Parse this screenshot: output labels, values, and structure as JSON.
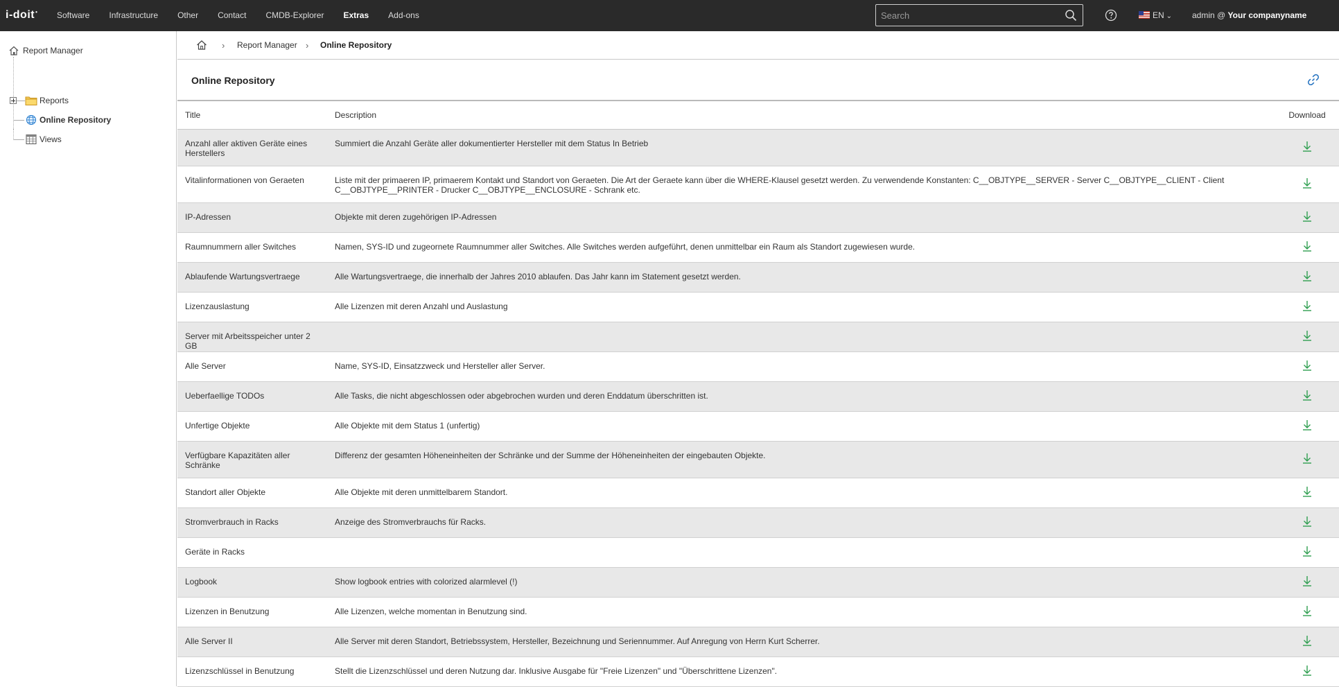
{
  "topbar": {
    "logo": "i-doit",
    "nav": [
      "Software",
      "Infrastructure",
      "Other",
      "Contact",
      "CMDB-Explorer",
      "Extras",
      "Add-ons"
    ],
    "active_nav": "Extras",
    "search_placeholder": "Search",
    "language": "EN",
    "user_prefix": "admin @",
    "company": "Your companyname"
  },
  "sidebar": {
    "root": "Report Manager",
    "items": [
      "Reports",
      "Online Repository",
      "Views"
    ],
    "active": "Online Repository"
  },
  "breadcrumb": {
    "items": [
      "Report Manager",
      "Online Repository"
    ]
  },
  "page": {
    "title": "Online Repository"
  },
  "table": {
    "columns": [
      "Title",
      "Description",
      "Download"
    ],
    "rows": [
      {
        "title": "Anzahl aller aktiven Geräte eines Herstellers",
        "description": "Summiert die Anzahl Geräte aller dokumentierter Hersteller mit dem Status In Betrieb"
      },
      {
        "title": "Vitalinformationen von Geraeten",
        "description": "Liste mit der primaeren IP, primaerem Kontakt und Standort von Geraeten. Die Art der Geraete kann über die WHERE-Klausel gesetzt werden. Zu verwendende Konstanten: C__OBJTYPE__SERVER - Server C__OBJTYPE__CLIENT - Client C__OBJTYPE__PRINTER - Drucker C__OBJTYPE__ENCLOSURE - Schrank etc."
      },
      {
        "title": "IP-Adressen",
        "description": "Objekte mit deren zugehörigen IP-Adressen"
      },
      {
        "title": "Raumnummern aller Switches",
        "description": "Namen, SYS-ID und zugeornete Raumnummer aller Switches. Alle Switches werden aufgeführt, denen unmittelbar ein Raum als Standort zugewiesen wurde."
      },
      {
        "title": "Ablaufende Wartungsvertraege",
        "description": "Alle Wartungsvertraege, die innerhalb der Jahres 2010 ablaufen. Das Jahr kann im Statement gesetzt werden."
      },
      {
        "title": "Lizenzauslastung",
        "description": "Alle Lizenzen mit deren Anzahl und Auslastung"
      },
      {
        "title": "Server mit Arbeitsspeicher unter 2 GB",
        "description": ""
      },
      {
        "title": "Alle Server",
        "description": "Name, SYS-ID, Einsatzzweck und Hersteller aller Server."
      },
      {
        "title": "Ueberfaellige TODOs",
        "description": "Alle Tasks, die nicht abgeschlossen oder abgebrochen wurden und deren Enddatum überschritten ist."
      },
      {
        "title": "Unfertige Objekte",
        "description": "Alle Objekte mit dem Status 1 (unfertig)"
      },
      {
        "title": "Verfügbare Kapazitäten aller Schränke",
        "description": "Differenz der gesamten Höheneinheiten der Schränke und der Summe der Höheneinheiten der eingebauten Objekte."
      },
      {
        "title": "Standort aller Objekte",
        "description": "Alle Objekte mit deren unmittelbarem Standort."
      },
      {
        "title": "Stromverbrauch in Racks",
        "description": "Anzeige des Stromverbrauchs für Racks."
      },
      {
        "title": "Geräte in Racks",
        "description": ""
      },
      {
        "title": "Logbook",
        "description": "Show logbook entries with colorized alarmlevel (!)"
      },
      {
        "title": "Lizenzen in Benutzung",
        "description": "Alle Lizenzen, welche momentan in Benutzung sind."
      },
      {
        "title": "Alle Server II",
        "description": "Alle Server mit deren Standort, Betriebssystem, Hersteller, Bezeichnung und Seriennummer. Auf Anregung von Herrn Kurt Scherrer."
      },
      {
        "title": "Lizenzschlüssel in Benutzung",
        "description": "Stellt die Lizenzschlüssel und deren Nutzung dar. Inklusive Ausgabe für \"Freie Lizenzen\" und \"Überschrittene Lizenzen\"."
      }
    ]
  },
  "colors": {
    "topbar": "#2a2a2a",
    "row_alt": "#e8e8e8",
    "download": "#2e9e4f",
    "link_icon": "#1f6fbf",
    "globe": "#2a7fcf",
    "folder": "#f5c542"
  },
  "icons": {
    "search": "search-icon",
    "help": "help-icon",
    "home": "home-icon",
    "link": "link-icon",
    "download": "download-icon"
  }
}
